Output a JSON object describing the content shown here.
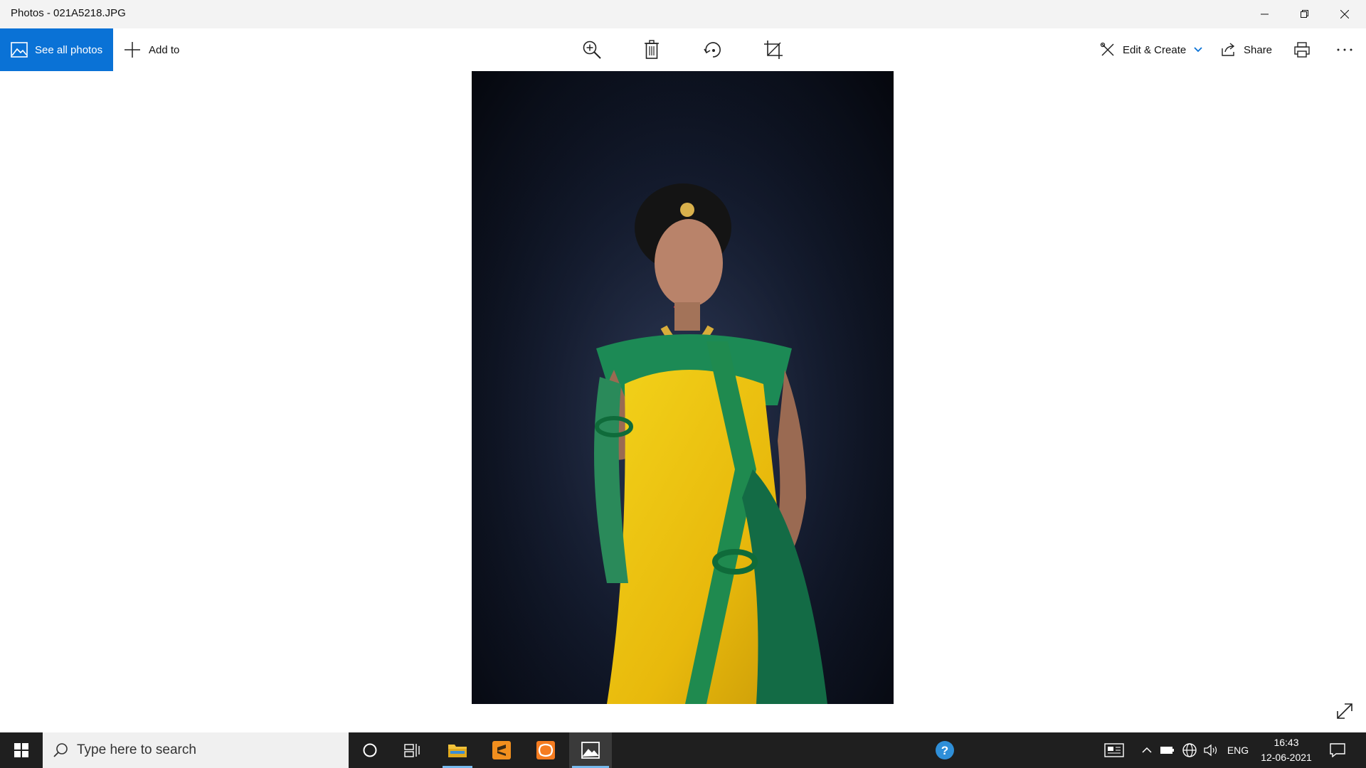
{
  "window": {
    "title": "Photos - 021A5218.JPG"
  },
  "toolbar": {
    "see_all_photos": "See all photos",
    "add_to": "Add to",
    "edit_create": "Edit & Create",
    "share": "Share"
  },
  "taskbar": {
    "search_placeholder": "Type here to search",
    "language": "ENG",
    "time": "16:43",
    "date": "12-06-2021"
  },
  "colors": {
    "accent": "#0a72d6",
    "taskbar": "#1f1f1f"
  }
}
